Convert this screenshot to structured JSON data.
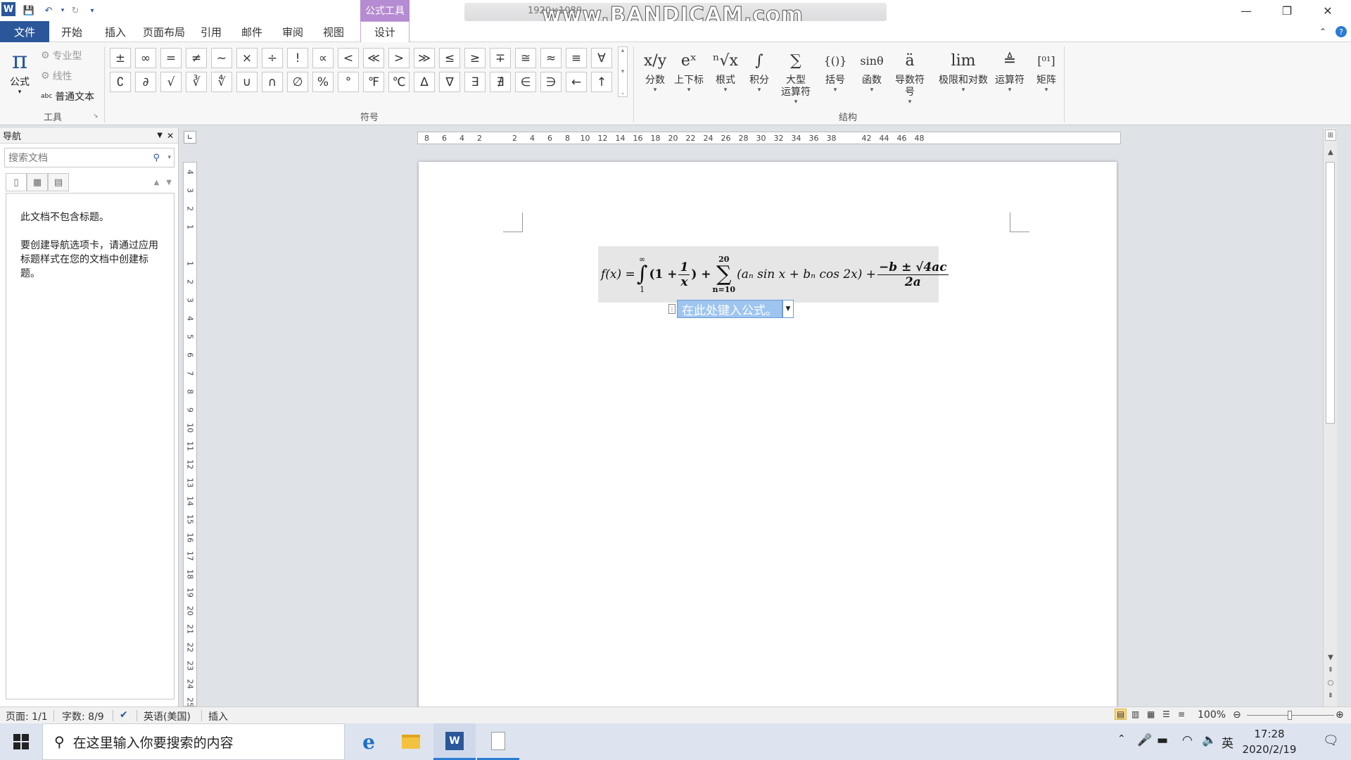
{
  "app": {
    "window_title": "",
    "context_tab_title": "公式工具",
    "watermark": "www.BANDICAM.com",
    "recording_resolution": "1920×1080"
  },
  "quick_access": [
    "save-icon",
    "undo-icon",
    "redo-icon",
    "customize-icon"
  ],
  "window_controls": [
    "minimize-icon",
    "restore-icon",
    "close-icon"
  ],
  "tabs": [
    {
      "label": "文件"
    },
    {
      "label": "开始"
    },
    {
      "label": "插入"
    },
    {
      "label": "页面布局"
    },
    {
      "label": "引用"
    },
    {
      "label": "邮件"
    },
    {
      "label": "审阅"
    },
    {
      "label": "视图"
    },
    {
      "label": "设计"
    }
  ],
  "ribbon": {
    "tools_group": {
      "label": "工具",
      "equation_label": "公式",
      "professional": "专业型",
      "linear": "线性",
      "normal_text": "普通文本"
    },
    "symbols_group": {
      "label": "符号",
      "row1": [
        "±",
        "∞",
        "=",
        "≠",
        "~",
        "×",
        "÷",
        "!",
        "∝",
        "<",
        "≪",
        ">",
        "≫",
        "≤",
        "≥",
        "∓",
        "≅",
        "≈",
        "≡",
        "∀"
      ],
      "row2": [
        "∁",
        "∂",
        "√",
        "∛",
        "∜",
        "∪",
        "∩",
        "∅",
        "%",
        "°",
        "℉",
        "℃",
        "∆",
        "∇",
        "∃",
        "∄",
        "∈",
        "∋",
        "←",
        "↑"
      ]
    },
    "structures_group": {
      "label": "结构",
      "items": [
        {
          "label": "分数",
          "glyph": "x/y"
        },
        {
          "label": "上下标",
          "glyph": "eˣ"
        },
        {
          "label": "根式",
          "glyph": "ⁿ√x"
        },
        {
          "label": "积分",
          "glyph": "∫"
        },
        {
          "label": "大型",
          "label2": "运算符",
          "glyph": "∑"
        },
        {
          "label": "括号",
          "glyph": "{()}"
        },
        {
          "label": "函数",
          "glyph": "sinθ"
        },
        {
          "label": "导数符号",
          "glyph": "ä"
        },
        {
          "label": "极限和对数",
          "glyph": "lim"
        },
        {
          "label": "运算符",
          "glyph": "≜"
        },
        {
          "label": "矩阵",
          "glyph": "[⁰¹]"
        }
      ]
    }
  },
  "nav": {
    "title": "导航",
    "search_placeholder": "搜索文档",
    "message1": "此文档不包含标题。",
    "message2": "要创建导航选项卡，请通过应用标题样式在您的文档中创建标题。"
  },
  "ruler": {
    "horizontal": [
      "8",
      "6",
      "4",
      "2",
      "",
      "2",
      "4",
      "6",
      "8",
      "10",
      "12",
      "14",
      "16",
      "18",
      "20",
      "22",
      "24",
      "26",
      "28",
      "30",
      "32",
      "34",
      "36",
      "38",
      "",
      "42",
      "44",
      "46",
      "48"
    ],
    "vertical": [
      "4",
      "3",
      "2",
      "1",
      "",
      "1",
      "2",
      "3",
      "4",
      "5",
      "6",
      "7",
      "8",
      "9",
      "10",
      "11",
      "12",
      "13",
      "14",
      "15",
      "16",
      "17",
      "18",
      "19",
      "20",
      "21",
      "22",
      "23",
      "24",
      "25"
    ]
  },
  "document": {
    "formula": {
      "lhs": "f(x) =",
      "int_upper": "∞",
      "int_lower": "1",
      "paren_open": "(1 +",
      "frac1_num": "1",
      "frac1_den": "x",
      "paren_close": ") +",
      "sum_upper": "20",
      "sum_lower": "n=10",
      "sum_body": "(aₙ sin x + bₙ cos 2x) +",
      "frac2_num": "−b ± √4ac",
      "frac2_den": "2a"
    },
    "placeholder": "在此处键入公式。"
  },
  "status": {
    "page": "页面: 1/1",
    "words": "字数: 8/9",
    "language": "英语(美国)",
    "mode": "插入",
    "zoom": "100%"
  },
  "taskbar": {
    "search_placeholder": "在这里输入你要搜索的内容",
    "ime": "英",
    "time": "17:28",
    "date": "2020/2/19"
  }
}
